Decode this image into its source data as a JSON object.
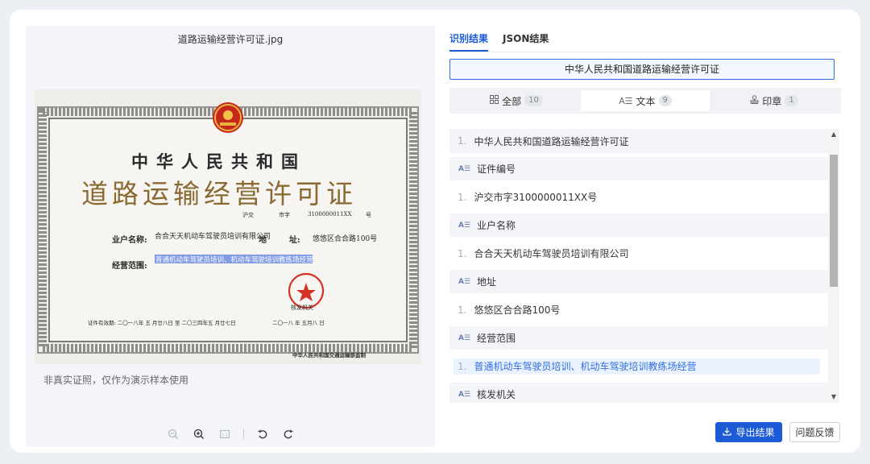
{
  "left": {
    "file_name": "道路运输经营许可证.jpg",
    "note": "非真实证照，仅作为演示样本使用",
    "certificate": {
      "title1": "中华人民共和国",
      "title2": "道路运输经营许可证",
      "prefix": "沪交",
      "zi": "市字",
      "number": "3100000011XX",
      "hao": "号",
      "business_name_label": "业户名称:",
      "business_name_value": "合合天天机动车驾驶员培训有限公司",
      "address_label": "地",
      "address_label2": "址:",
      "address_value": "悠悠区合合路100号",
      "scope_label": "经营范围:",
      "scope_value": "普通机动车驾驶员培训、机动车驾驶培训教练场经营",
      "validity": "证件有效期: 二〇一八年 五 月廿八日 至 二〇三四年五 月廿七日",
      "issue_date": "二〇一八 年  五月八 日",
      "seal_text": "核发机关",
      "footer": "中华人民共和国交通运输部监制"
    },
    "zoom_icons": [
      "zoom-out-icon",
      "zoom-in-icon",
      "fit-icon",
      "rotate-left-icon",
      "rotate-right-icon"
    ]
  },
  "right": {
    "tabs": [
      {
        "label": "识别结果",
        "active": true
      },
      {
        "label": "JSON结果",
        "active": false
      }
    ],
    "doc_title": "中华人民共和国道路运输经营许可证",
    "filters": [
      {
        "label": "全部",
        "count": "10",
        "icon": "grid-icon"
      },
      {
        "label": "文本",
        "count": "9",
        "icon": "text-icon"
      },
      {
        "label": "印章",
        "count": "1",
        "icon": "stamp-icon"
      }
    ],
    "first_item": {
      "num": "1.",
      "value": "中华人民共和国道路运输经营许可证"
    },
    "sections": [
      {
        "header": "证件编号",
        "num": "1.",
        "value": "沪交市字3100000011XX号"
      },
      {
        "header": "业户名称",
        "num": "1.",
        "value": "合合天天机动车驾驶员培训有限公司"
      },
      {
        "header": "地址",
        "num": "1.",
        "value": "悠悠区合合路100号"
      },
      {
        "header": "经营范围",
        "num": "1.",
        "value": "普通机动车驾驶员培训、机动车驾驶培训教练场经营"
      },
      {
        "header": "核发机关"
      }
    ],
    "export_label": "导出结果",
    "feedback_label": "问题反馈",
    "accent_color": "#1c5ad6"
  }
}
